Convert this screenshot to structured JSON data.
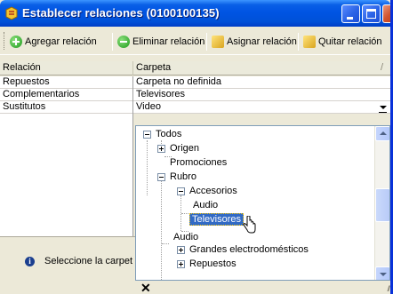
{
  "window": {
    "title": "Establecer relaciones (0100100135)"
  },
  "toolbar": {
    "add_label": "Agregar relación",
    "remove_label": "Eliminar relación",
    "assign_label": "Asignar relación",
    "unassign_label": "Quitar relación"
  },
  "grid": {
    "col_relacion": "Relación",
    "col_carpeta": "Carpeta",
    "col_extra": "/",
    "rows": [
      {
        "relacion": "Repuestos",
        "carpeta": "Carpeta no definida"
      },
      {
        "relacion": "Complementarios",
        "carpeta": "Televisores"
      },
      {
        "relacion": "Sustitutos",
        "carpeta": "Video"
      }
    ]
  },
  "tree": {
    "nodes": [
      {
        "label": "Todos",
        "expander": "minus"
      },
      {
        "label": "Origen",
        "expander": "plus"
      },
      {
        "label": "Promociones",
        "expander": "none"
      },
      {
        "label": "Rubro",
        "expander": "minus"
      },
      {
        "label": "Accesorios",
        "expander": "minus"
      },
      {
        "label": "Audio",
        "expander": "none"
      },
      {
        "label": "Televisores",
        "expander": "none",
        "selected": true
      },
      {
        "label": "Audio",
        "expander": "none"
      },
      {
        "label": "Grandes electrodomésticos",
        "expander": "plus"
      },
      {
        "label": "Repuestos",
        "expander": "plus"
      }
    ]
  },
  "info": {
    "text": "Seleccione la carpet"
  },
  "bottom": {
    "close_glyph": "✕",
    "grip_glyph": "///"
  },
  "colors": {
    "titlebar": "#0054e3",
    "selection": "#316ac5",
    "face": "#ece9d8"
  }
}
